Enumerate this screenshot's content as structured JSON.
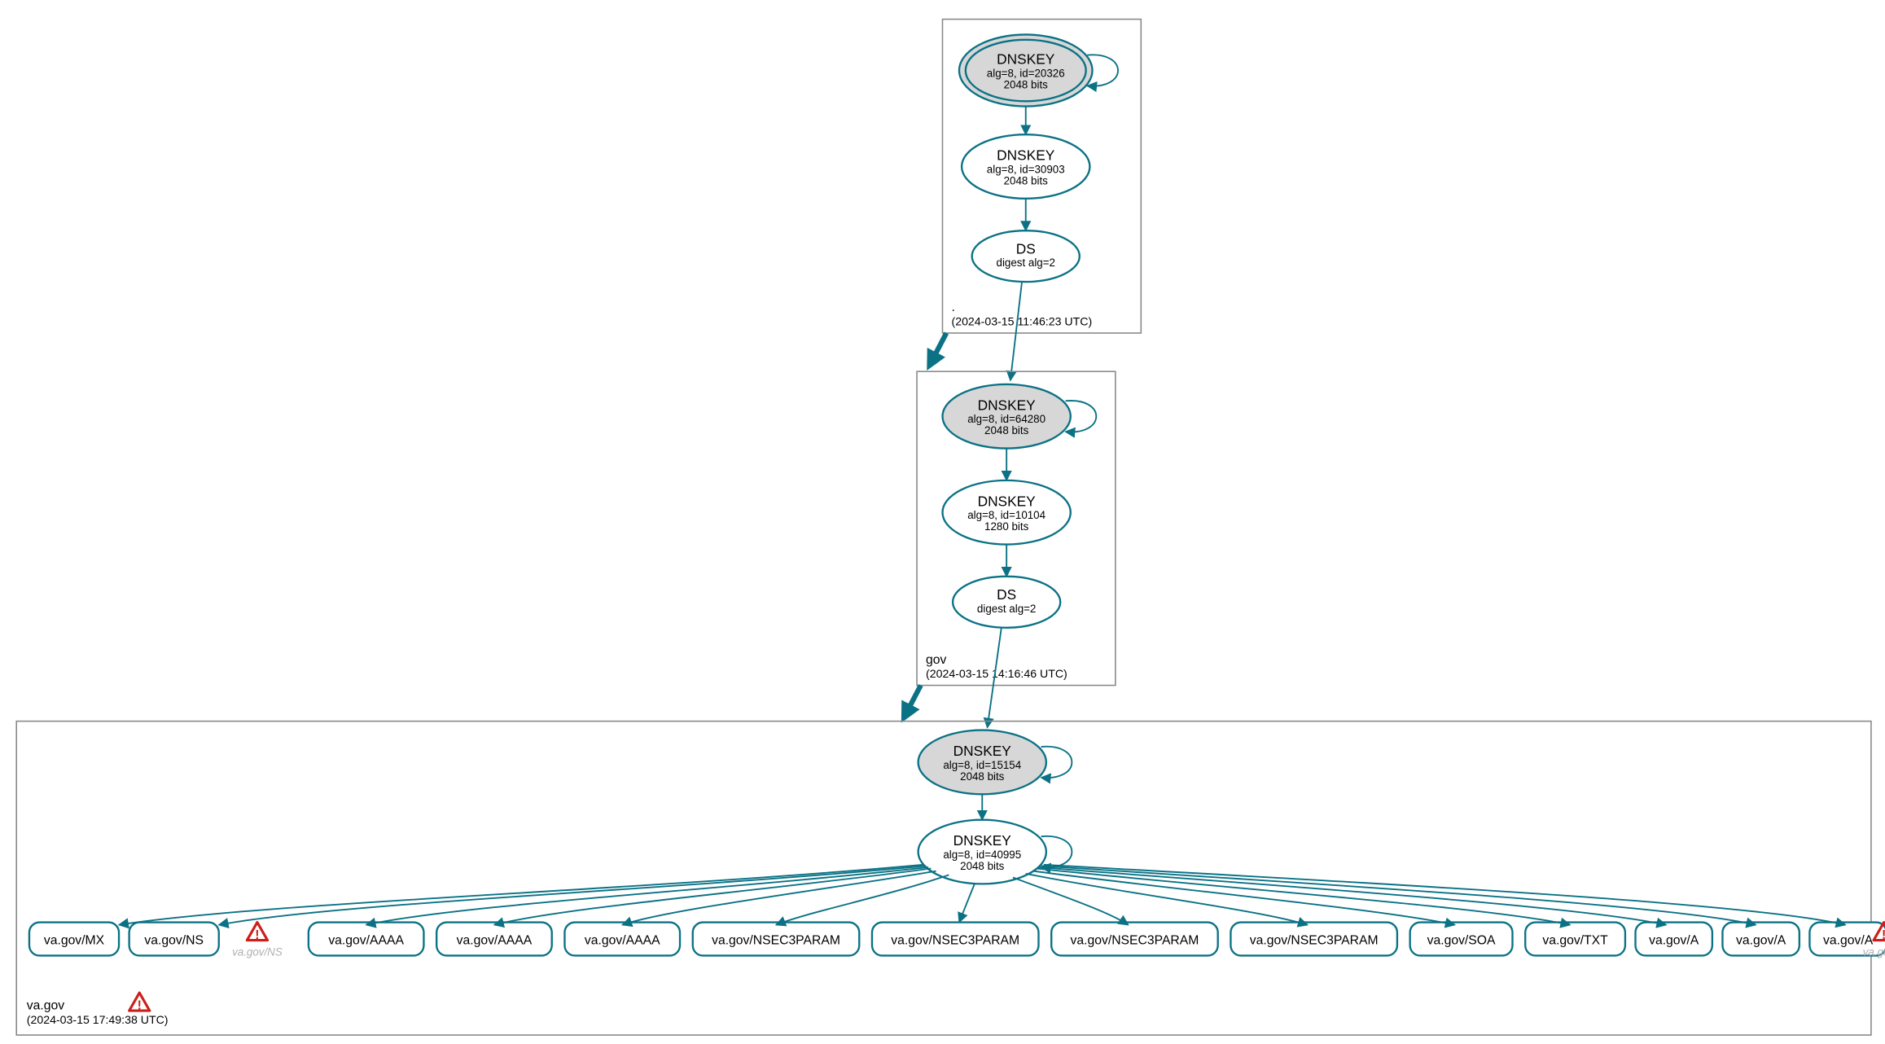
{
  "colors": {
    "stroke": "#0b7285",
    "ksk_fill": "#d7d7d7",
    "zsk_fill": "#ffffff",
    "warn": "#cc1f1a"
  },
  "zones": {
    "root": {
      "label": ".",
      "timestamp": "(2024-03-15 11:46:23 UTC)",
      "ksk": {
        "title": "DNSKEY",
        "line1": "alg=8, id=20326",
        "line2": "2048 bits"
      },
      "zsk": {
        "title": "DNSKEY",
        "line1": "alg=8, id=30903",
        "line2": "2048 bits"
      },
      "ds": {
        "title": "DS",
        "line1": "digest alg=2"
      }
    },
    "gov": {
      "label": "gov",
      "timestamp": "(2024-03-15 14:16:46 UTC)",
      "ksk": {
        "title": "DNSKEY",
        "line1": "alg=8, id=64280",
        "line2": "2048 bits"
      },
      "zsk": {
        "title": "DNSKEY",
        "line1": "alg=8, id=10104",
        "line2": "1280 bits"
      },
      "ds": {
        "title": "DS",
        "line1": "digest alg=2"
      }
    },
    "va": {
      "label": "va.gov",
      "timestamp": "(2024-03-15 17:49:38 UTC)",
      "ksk": {
        "title": "DNSKEY",
        "line1": "alg=8, id=15154",
        "line2": "2048 bits"
      },
      "zsk": {
        "title": "DNSKEY",
        "line1": "alg=8, id=40995",
        "line2": "2048 bits"
      }
    }
  },
  "rrsets": {
    "r0": "va.gov/MX",
    "r1": "va.gov/NS",
    "r2": "va.gov/AAAA",
    "r3": "va.gov/AAAA",
    "r4": "va.gov/AAAA",
    "r5": "va.gov/NSEC3PARAM",
    "r6": "va.gov/NSEC3PARAM",
    "r7": "va.gov/NSEC3PARAM",
    "r8": "va.gov/NSEC3PARAM",
    "r9": "va.gov/SOA",
    "r10": "va.gov/TXT",
    "r11": "va.gov/A",
    "r12": "va.gov/A",
    "r13": "va.gov/A"
  },
  "warnings": {
    "w_ns": "va.gov/NS",
    "w_a": "va.gov/A",
    "w_zone": ""
  }
}
